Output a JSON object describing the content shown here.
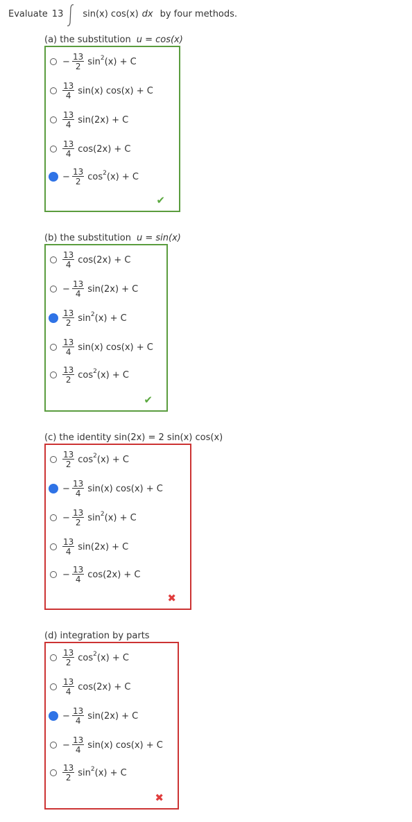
{
  "question": {
    "prefix": "Evaluate",
    "coefficient": "13",
    "integrand": "sin(x) cos(x)",
    "differential": "dx",
    "suffix": "by four methods."
  },
  "parts": [
    {
      "label": "(a) the substitution",
      "var_text": "u = cos(x)",
      "status": "correct",
      "options": [
        {
          "sign": "−",
          "num": "13",
          "den": "2",
          "fn": "sin",
          "power": "2",
          "arg": "(x) + C",
          "selected": false
        },
        {
          "sign": "",
          "num": "13",
          "den": "4",
          "fn": "sin(x) cos(x) + C",
          "power": "",
          "arg": "",
          "selected": false
        },
        {
          "sign": "",
          "num": "13",
          "den": "4",
          "fn": "sin(2x) + C",
          "power": "",
          "arg": "",
          "selected": false
        },
        {
          "sign": "",
          "num": "13",
          "den": "4",
          "fn": "cos(2x) + C",
          "power": "",
          "arg": "",
          "selected": false
        },
        {
          "sign": "−",
          "num": "13",
          "den": "2",
          "fn": "cos",
          "power": "2",
          "arg": "(x) + C",
          "selected": true
        }
      ]
    },
    {
      "label": "(b) the substitution",
      "var_text": "u = sin(x)",
      "status": "correct",
      "options": [
        {
          "sign": "",
          "num": "13",
          "den": "4",
          "fn": "cos(2x) + C",
          "power": "",
          "arg": "",
          "selected": false
        },
        {
          "sign": "−",
          "num": "13",
          "den": "4",
          "fn": "sin(2x) + C",
          "power": "",
          "arg": "",
          "selected": false
        },
        {
          "sign": "",
          "num": "13",
          "den": "2",
          "fn": "sin",
          "power": "2",
          "arg": "(x) + C",
          "selected": true
        },
        {
          "sign": "",
          "num": "13",
          "den": "4",
          "fn": "sin(x) cos(x) + C",
          "power": "",
          "arg": "",
          "selected": false
        },
        {
          "sign": "",
          "num": "13",
          "den": "2",
          "fn": "cos",
          "power": "2",
          "arg": "(x) + C",
          "selected": false
        }
      ]
    },
    {
      "label": "(c) the identity  sin(2x) = 2 sin(x) cos(x)",
      "var_text": "",
      "status": "wrong",
      "options": [
        {
          "sign": "",
          "num": "13",
          "den": "2",
          "fn": "cos",
          "power": "2",
          "arg": "(x) + C",
          "selected": false
        },
        {
          "sign": "−",
          "num": "13",
          "den": "4",
          "fn": "sin(x) cos(x) + C",
          "power": "",
          "arg": "",
          "selected": true
        },
        {
          "sign": "−",
          "num": "13",
          "den": "2",
          "fn": "sin",
          "power": "2",
          "arg": "(x) + C",
          "selected": false
        },
        {
          "sign": "",
          "num": "13",
          "den": "4",
          "fn": "sin(2x) + C",
          "power": "",
          "arg": "",
          "selected": false
        },
        {
          "sign": "−",
          "num": "13",
          "den": "4",
          "fn": "cos(2x) + C",
          "power": "",
          "arg": "",
          "selected": false
        }
      ]
    },
    {
      "label": "(d) integration by parts",
      "var_text": "",
      "status": "wrong",
      "options": [
        {
          "sign": "",
          "num": "13",
          "den": "2",
          "fn": "cos",
          "power": "2",
          "arg": "(x) + C",
          "selected": false
        },
        {
          "sign": "",
          "num": "13",
          "den": "4",
          "fn": "cos(2x) + C",
          "power": "",
          "arg": "",
          "selected": false
        },
        {
          "sign": "−",
          "num": "13",
          "den": "4",
          "fn": "sin(2x) + C",
          "power": "",
          "arg": "",
          "selected": true
        },
        {
          "sign": "−",
          "num": "13",
          "den": "4",
          "fn": "sin(x) cos(x) + C",
          "power": "",
          "arg": "",
          "selected": false
        },
        {
          "sign": "",
          "num": "13",
          "den": "2",
          "fn": "sin",
          "power": "2",
          "arg": "(x) + C",
          "selected": false
        }
      ]
    }
  ],
  "marks": {
    "correct": "✔",
    "wrong": "✖"
  },
  "colors": {
    "correct_border": "#5a9c3e",
    "wrong_border": "#cc3333",
    "selected_radio": "#2f73e6"
  }
}
